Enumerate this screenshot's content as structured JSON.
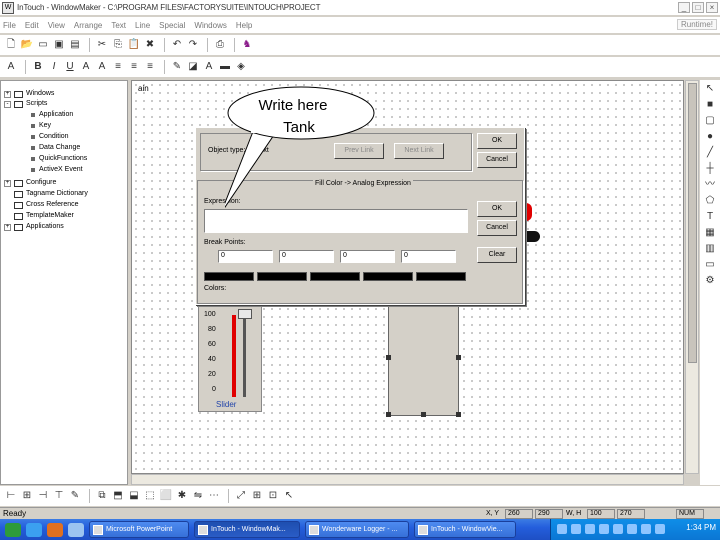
{
  "title": "InTouch - WindowMaker - C:\\PROGRAM FILES\\FACTORYSUITE\\INTOUCH\\PROJECT",
  "menu": [
    "File",
    "Edit",
    "View",
    "Arrange",
    "Text",
    "Line",
    "Special",
    "Windows",
    "Help"
  ],
  "runtime_label": "Runtime!",
  "tree": {
    "windows": "Windows",
    "scripts": "Scripts",
    "scripts_children": [
      "Application",
      "Key",
      "Condition",
      "Data Change",
      "QuickFunctions",
      "ActiveX Event"
    ],
    "configure": "Configure",
    "tagname_dictionary": "Tagname Dictionary",
    "cross_reference": "Cross Reference",
    "templatemaker": "TemplateMaker",
    "applications": "Applications"
  },
  "canvas_title": "ain",
  "callout_text_1": "Write here",
  "callout_text_2": "Tank",
  "dialog": {
    "object_type_label": "Object type:",
    "object_type_value": "Text",
    "prev_link": "Prev Link",
    "next_link": "Next Link",
    "ok": "OK",
    "cancel": "Cancel",
    "section_title": "Fill Color -> Analog Expression",
    "expression_label": "Expression:",
    "expression_value": "",
    "break_points_label": "Break Points:",
    "break_points": [
      "0",
      "0",
      "0",
      "0"
    ],
    "colors_label": "Colors:",
    "inner_ok": "OK",
    "inner_cancel": "Cancel",
    "clear": "Clear"
  },
  "slider": {
    "ticks": [
      "100",
      "80",
      "60",
      "40",
      "20",
      "0"
    ],
    "label": "Slider"
  },
  "status": {
    "ready": "Ready",
    "xy_label": "X, Y",
    "x": "260",
    "y": "290",
    "w_label": "W, H",
    "w": "100",
    "h": "270",
    "num": "NUM"
  },
  "taskbar": {
    "tasks": [
      "Microsoft PowerPoint",
      "InTouch - WindowMak...",
      "Wonderware Logger - ...",
      "InTouch - WindowVie..."
    ],
    "active_index": 1,
    "clock": "1:34 PM"
  },
  "colors": {
    "slider_red": "#e00000",
    "taskbar_blue": "#245edc"
  }
}
